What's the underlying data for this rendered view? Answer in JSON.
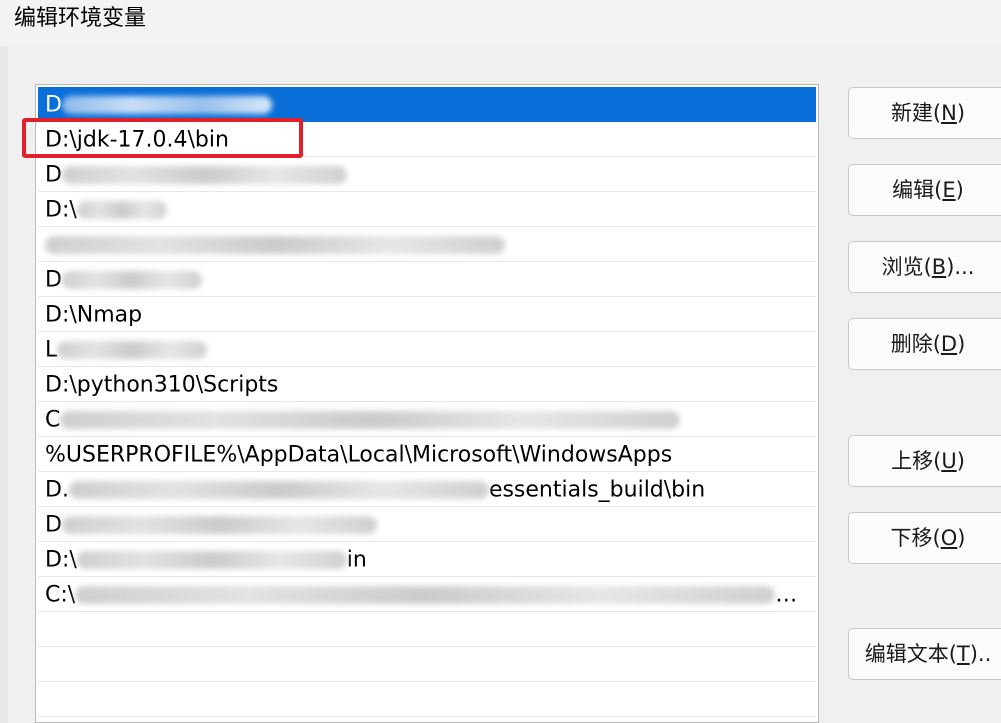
{
  "window": {
    "title": "编辑环境变量"
  },
  "path_list": {
    "items": [
      {
        "prefix": "D",
        "visible": "",
        "blur_width": 210,
        "selected": true
      },
      {
        "prefix": "",
        "visible": "D:\\jdk-17.0.4\\bin",
        "blur_width": 0,
        "selected": false
      },
      {
        "prefix": "D",
        "visible": "",
        "blur_width": 285,
        "selected": false
      },
      {
        "prefix": "D:\\",
        "visible": "",
        "blur_width": 90,
        "selected": false
      },
      {
        "prefix": "",
        "visible": "",
        "blur_width": 460,
        "selected": false
      },
      {
        "prefix": "D",
        "visible": "",
        "blur_width": 140,
        "selected": false
      },
      {
        "prefix": "",
        "visible": "D:\\Nmap",
        "blur_width": 0,
        "selected": false
      },
      {
        "prefix": "L",
        "visible": "",
        "blur_width": 150,
        "selected": false
      },
      {
        "prefix": "",
        "visible": "D:\\python310\\Scripts",
        "blur_width": 0,
        "selected": false
      },
      {
        "prefix": "C",
        "visible": "",
        "blur_width": 620,
        "selected": false
      },
      {
        "prefix": "",
        "visible": "%USERPROFILE%\\AppData\\Local\\Microsoft\\WindowsApps",
        "blur_width": 0,
        "selected": false
      },
      {
        "prefix": "D.",
        "visible": "essentials_build\\bin",
        "blur_width": 420,
        "selected": false
      },
      {
        "prefix": "D",
        "visible": "",
        "blur_width": 315,
        "selected": false
      },
      {
        "prefix": "D:\\",
        "visible": "in",
        "blur_width": 270,
        "selected": false
      },
      {
        "prefix": "C:\\",
        "visible": "…",
        "blur_width": 700,
        "selected": false
      },
      {
        "prefix": "",
        "visible": "",
        "blur_width": 0,
        "selected": false
      },
      {
        "prefix": "",
        "visible": "",
        "blur_width": 0,
        "selected": false
      },
      {
        "prefix": "",
        "visible": "",
        "blur_width": 0,
        "selected": false
      }
    ]
  },
  "buttons": {
    "new": "新建(",
    "new_key": "N",
    "new_end": ")",
    "edit": "编辑(",
    "edit_key": "E",
    "edit_end": ")",
    "browse": "浏览(",
    "browse_key": "B",
    "browse_end": ")...",
    "delete": "删除(",
    "delete_key": "D",
    "delete_end": ")",
    "move_up": "上移(",
    "move_up_key": "U",
    "move_up_end": ")",
    "move_down": "下移(",
    "move_down_key": "O",
    "move_down_end": ")",
    "edit_text": "编辑文本(",
    "edit_text_key": "T",
    "edit_text_end": ").."
  }
}
